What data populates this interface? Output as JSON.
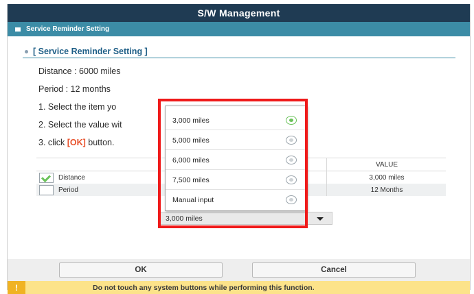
{
  "window": {
    "title": "S/W Management"
  },
  "subheader": {
    "label": "Service Reminder Setting"
  },
  "section": {
    "title": "[ Service Reminder Setting ]"
  },
  "info": {
    "distance": "Distance : 6000 miles",
    "period": "Period : 12 months",
    "step1": "1. Select the item yo",
    "step2": "2. Select the value wit",
    "step3_prefix": "3. click ",
    "step3_ok": "[OK]",
    "step3_suffix": " button."
  },
  "table": {
    "value_header": "VALUE",
    "rows": [
      {
        "label": "Distance",
        "checked": true,
        "value": "3,000 miles"
      },
      {
        "label": "Period",
        "checked": false,
        "value": "12 Months"
      }
    ]
  },
  "dropdown": {
    "selected": "3,000 miles",
    "options": [
      {
        "label": "3,000 miles",
        "selected": true
      },
      {
        "label": "5,000 miles",
        "selected": false
      },
      {
        "label": "6,000 miles",
        "selected": false
      },
      {
        "label": "7,500 miles",
        "selected": false
      },
      {
        "label": "Manual input",
        "selected": false
      }
    ]
  },
  "buttons": {
    "ok": "OK",
    "cancel": "Cancel"
  },
  "warning": {
    "icon": "!",
    "text": "Do not touch any system buttons while performing this function."
  },
  "colors": {
    "title_bar": "#1f3b53",
    "sub_bar": "#3c8ca6",
    "highlight": "#ef1a1a",
    "accent_green": "#6ac259",
    "warning_bg": "#fce38a"
  }
}
